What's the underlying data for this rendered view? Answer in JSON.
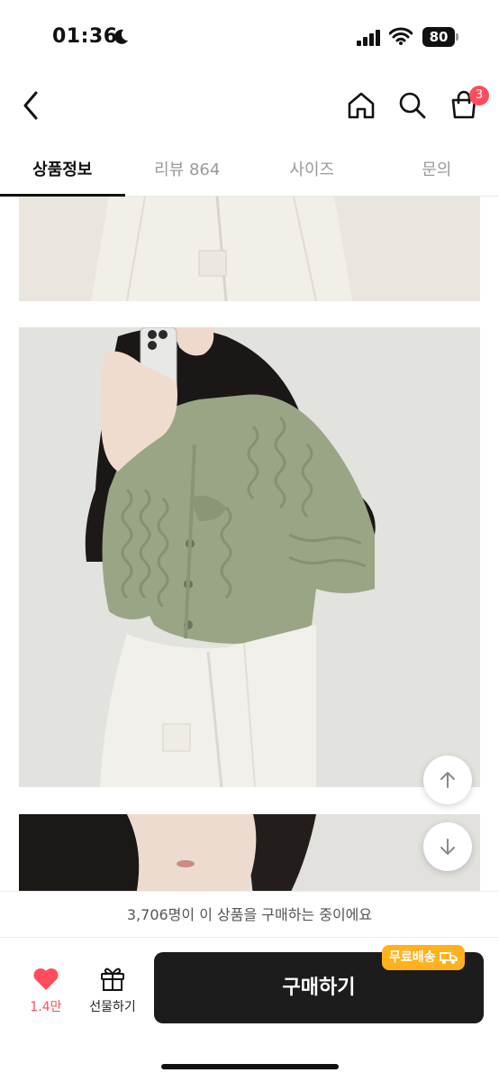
{
  "status_bar": {
    "time": "01:36",
    "battery": "80"
  },
  "header": {
    "cart_count": "3"
  },
  "tabs": [
    {
      "label": "상품정보"
    },
    {
      "label": "리뷰 864"
    },
    {
      "label": "사이즈"
    },
    {
      "label": "문의"
    }
  ],
  "buyers_banner": "3,706명이 이 상품을 구매하는 중이에요",
  "bottom_bar": {
    "like_count": "1.4만",
    "gift_label": "선물하기",
    "buy_label": "구매하기",
    "free_shipping": "무료배송"
  },
  "colors": {
    "accent": "#ff4d5e",
    "buy_button": "#1c1c1c",
    "shipping_badge": "#ffb21e"
  },
  "icons": [
    "back-icon",
    "home-icon",
    "search-icon",
    "cart-icon",
    "arrow-up-icon",
    "arrow-down-icon",
    "heart-icon",
    "gift-icon",
    "truck-icon"
  ]
}
